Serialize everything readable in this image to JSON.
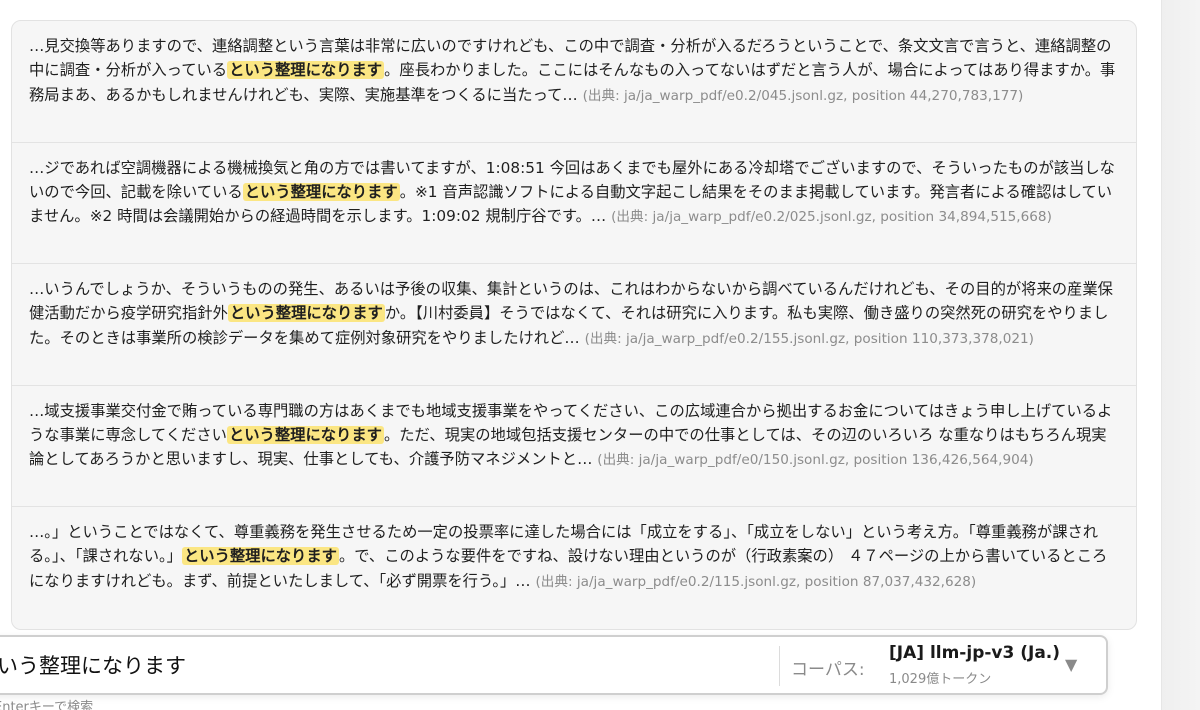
{
  "results": [
    {
      "before": "…見交換等ありますので、連絡調整という言葉は非常に広いのですけれども、この中で調査・分析が入るだろうということで、条文文言で言うと、連絡調整の中に調査・分析が入っている",
      "highlight": "という整理になります",
      "after": "。座長わかりました。ここにはそんなもの入ってないはずだと言う人が、場合によってはあり得ますか。事務局まあ、あるかもしれませんけれども、実際、実施基準をつくるに当たって…",
      "source": "(出典: ja/ja_warp_pdf/e0.2/045.jsonl.gz, position 44,270,783,177)"
    },
    {
      "before": "…ジであれば空調機器による機械換気と角の方では書いてますが、1:08:51 今回はあくまでも屋外にある冷却塔でございますので、そういったものが該当しないので今回、記載を除いている",
      "highlight": "という整理になります",
      "after": "。※1 音声認識ソフトによる自動文字起こし結果をそのまま掲載しています。発言者による確認はしていません。※2 時間は会議開始からの経過時間を示します。1:09:02 規制庁谷です。…",
      "source": "(出典: ja/ja_warp_pdf/e0.2/025.jsonl.gz, position 34,894,515,668)"
    },
    {
      "before": "…いうんでしょうか、そういうものの発生、あるいは予後の収集、集計というのは、これはわからないから調べているんだけれども、その目的が将来の産業保健活動だから疫学研究指針外",
      "highlight": "という整理になります",
      "after": "か。【川村委員】そうではなくて、それは研究に入ります。私も実際、働き盛りの突然死の研究をやりました。そのときは事業所の検診データを集めて症例対象研究をやりましたけれど…",
      "source": "(出典: ja/ja_warp_pdf/e0.2/155.jsonl.gz, position 110,373,378,021)"
    },
    {
      "before": "…域支援事業交付金で賄っている専門職の方はあくまでも地域支援事業をやってください、この広域連合から拠出するお金についてはきょう申し上げているような事業に専念してください",
      "highlight": "という整理になります",
      "after": "。ただ、現実の地域包括支援センターの中での仕事としては、その辺のいろいろ な重なりはもちろん現実論としてあろうかと思いますし、現実、仕事としても、介護予防マネジメントと…",
      "source": "(出典: ja/ja_warp_pdf/e0/150.jsonl.gz, position 136,426,564,904)"
    },
    {
      "before": "…。」ということではなくて、尊重義務を発生させるため一定の投票率に達した場合には「成立をする」、「成立をしない」という考え方。「尊重義務が課される。」、「課されない。」",
      "highlight": "という整理になります",
      "after": "。で、このような要件をですね、設けない理由というのが（行政素案の） ４７ページの上から書いているところになりますけれども。まず、前提といたしまして、「必ず開票を行う。」…",
      "source": "(出典: ja/ja_warp_pdf/e0.2/115.jsonl.gz, position 87,037,432,628)"
    }
  ],
  "search": {
    "query": "という整理になります",
    "corpus_label": "コーパス:",
    "corpus_name": "[JA] llm-jp-v3 (Ja.)",
    "corpus_tokens": "1,029億トークン",
    "dropdown_icon": "▼",
    "hint": "Enterキーで検索"
  },
  "colors": {
    "highlight": "#fbe683",
    "source_text": "#8c8c8c"
  }
}
